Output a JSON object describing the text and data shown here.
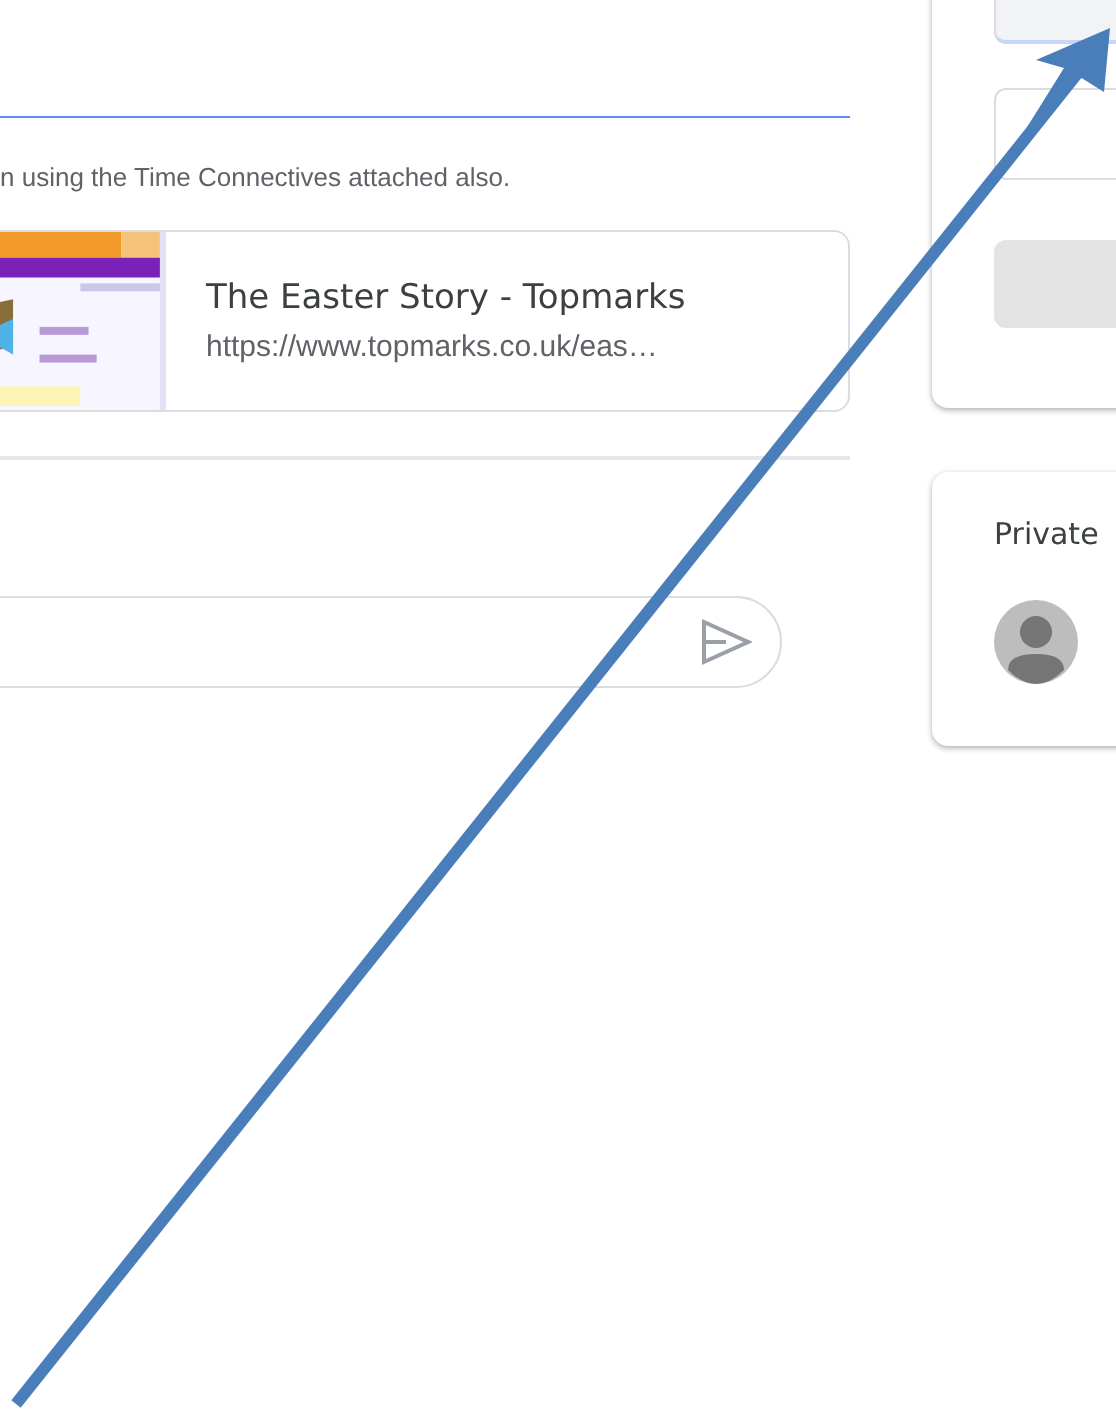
{
  "post": {
    "description": "n using the Time Connectives attached also.",
    "attachment": {
      "kind": "picture",
      "title": "The Easter Story - Topmarks",
      "url": "https://www.topmarks.co.uk/eas…"
    }
  },
  "comment": {
    "send_disabled": true
  },
  "private_comments": {
    "title": "Private"
  }
}
